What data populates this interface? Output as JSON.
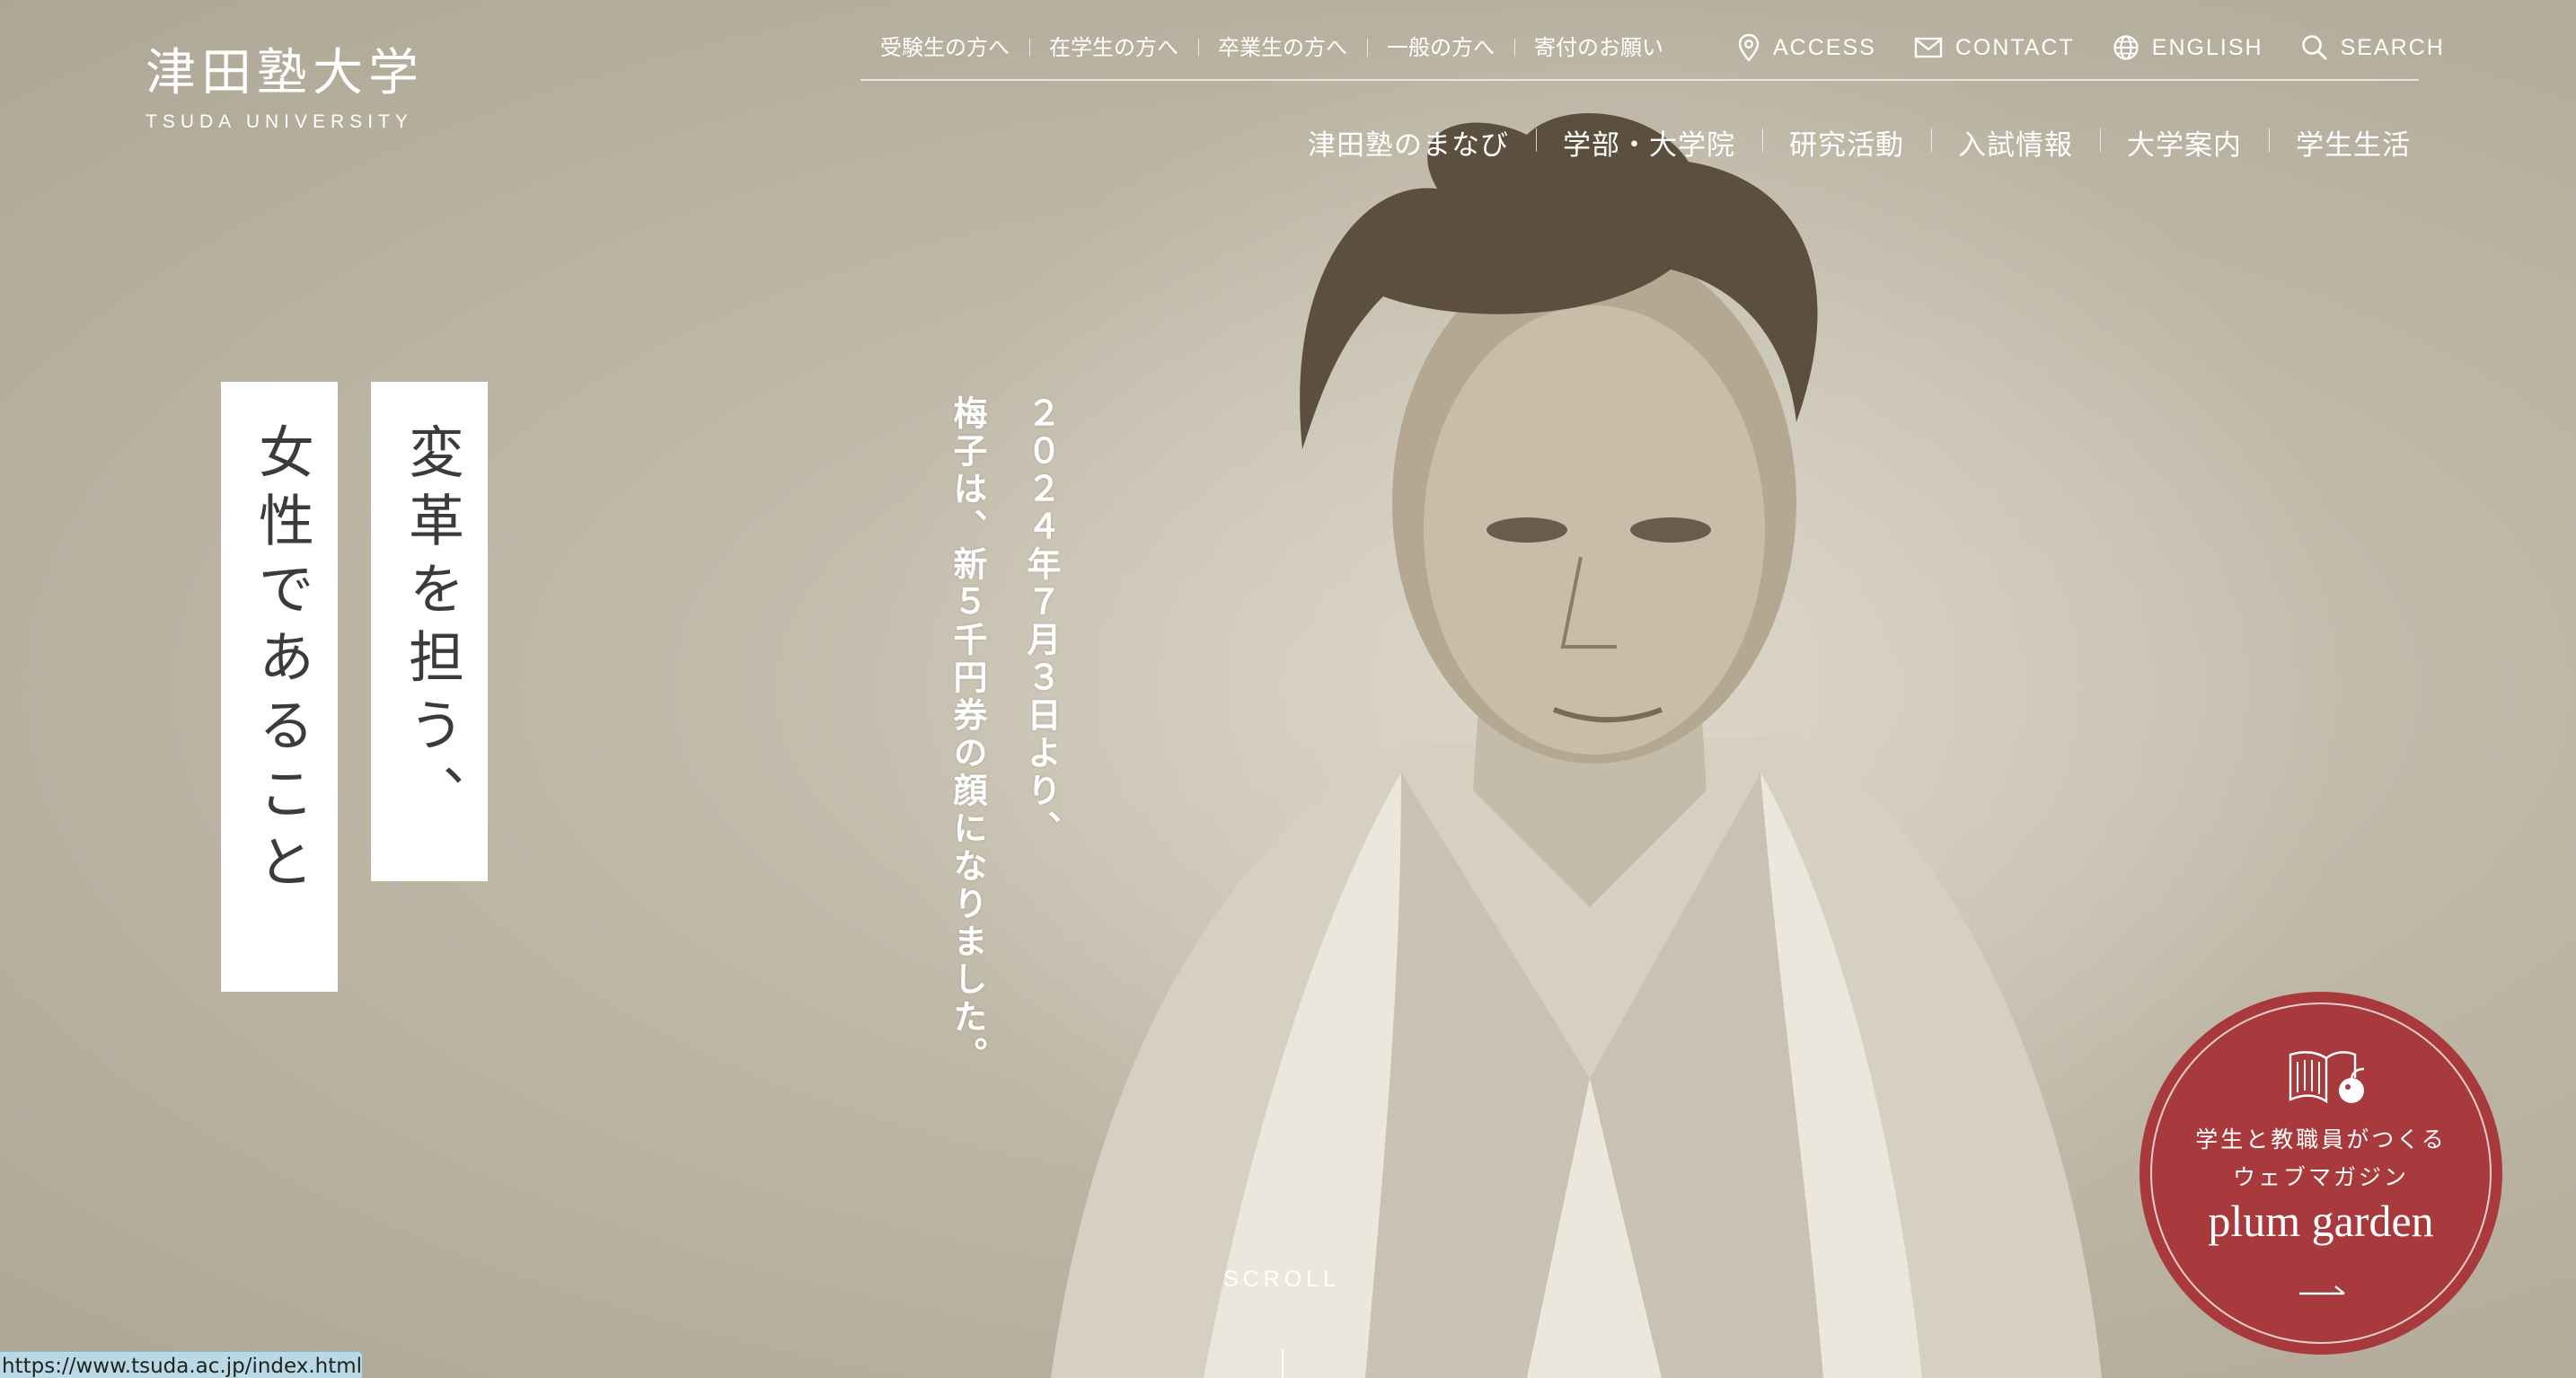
{
  "logo": {
    "jp": "津田塾大学",
    "en": "TSUDA UNIVERSITY"
  },
  "utility_nav": {
    "audience_links": [
      "受験生の方へ",
      "在学生の方へ",
      "卒業生の方へ",
      "一般の方へ",
      "寄付のお願い"
    ],
    "access": "ACCESS",
    "contact": "CONTACT",
    "english": "ENGLISH",
    "search": "SEARCH"
  },
  "main_nav": [
    "津田塾のまなび",
    "学部・大学院",
    "研究活動",
    "入試情報",
    "大学案内",
    "学生生活"
  ],
  "hero": {
    "tagline": [
      "変革を担う、",
      "女性であること"
    ],
    "news": "２０２４年７月３日より、\n梅子は、新５千円券の顔になりました。",
    "scroll": "SCROLL"
  },
  "plum_garden": {
    "line1": "学生と教職員がつくる",
    "line2": "ウェブマガジン",
    "title": "plum garden"
  },
  "status_bar": {
    "url": "https://www.tsuda.ac.jp/index.html"
  },
  "colors": {
    "plum": "#a83a3e",
    "background": "#c4bdad",
    "tagline_box": "#ffffff"
  },
  "icons": {
    "access": "map-pin-icon",
    "contact": "mail-icon",
    "english": "globe-icon",
    "search": "search-icon",
    "plum": "book-plum-icon",
    "arrow": "arrow-right-icon"
  }
}
